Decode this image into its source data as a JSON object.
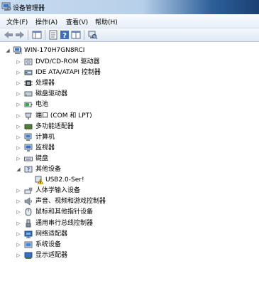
{
  "window": {
    "title": "设备管理器"
  },
  "menu": [
    "文件(F)",
    "操作(A)",
    "查看(V)",
    "帮助(H)"
  ],
  "tree": {
    "root": "WIN-170H7GN8RCI",
    "items": [
      {
        "label": "DVD/CD-ROM 驱动器",
        "icon": "dvd-drive-icon"
      },
      {
        "label": "IDE ATA/ATAPI 控制器",
        "icon": "ide-controller-icon"
      },
      {
        "label": "处理器",
        "icon": "processor-icon"
      },
      {
        "label": "磁盘驱动器",
        "icon": "disk-drive-icon"
      },
      {
        "label": "电池",
        "icon": "battery-icon"
      },
      {
        "label": "端口 (COM 和 LPT)",
        "icon": "port-icon"
      },
      {
        "label": "多功能适配器",
        "icon": "multifunction-adapter-icon"
      },
      {
        "label": "计算机",
        "icon": "computer-icon"
      },
      {
        "label": "监视器",
        "icon": "monitor-icon"
      },
      {
        "label": "键盘",
        "icon": "keyboard-icon"
      },
      {
        "label": "其他设备",
        "icon": "other-devices-icon",
        "expanded": true
      },
      {
        "label": "USB2.0-Ser!",
        "icon": "unknown-device-warning-icon",
        "child": true
      },
      {
        "label": "人体学输入设备",
        "icon": "hid-icon"
      },
      {
        "label": "声音、视频和游戏控制器",
        "icon": "sound-icon"
      },
      {
        "label": "鼠标和其他指针设备",
        "icon": "mouse-icon"
      },
      {
        "label": "通用串行总线控制器",
        "icon": "usb-controller-icon"
      },
      {
        "label": "网络适配器",
        "icon": "network-adapter-icon"
      },
      {
        "label": "系统设备",
        "icon": "system-devices-icon"
      },
      {
        "label": "显示适配器",
        "icon": "display-adapter-icon"
      }
    ]
  }
}
